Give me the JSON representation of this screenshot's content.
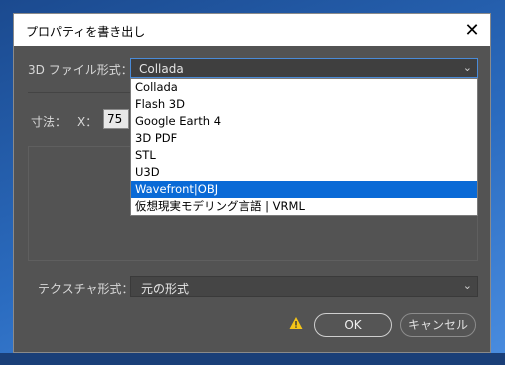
{
  "window": {
    "title": "プロパティを書き出し"
  },
  "format_row": {
    "label": "3D ファイル形式：",
    "selected": "Collada",
    "options": [
      "Collada",
      "Flash 3D",
      "Google Earth 4",
      "3D PDF",
      "STL",
      "U3D",
      "Wavefront|OBJ",
      "仮想現実モデリング言語 | VRML"
    ],
    "highlighted": "Wavefront|OBJ"
  },
  "size_row": {
    "label": "寸法：",
    "x_label": "X：",
    "x_value": "75"
  },
  "texture_row": {
    "label": "テクスチャ形式：",
    "selected": "元の形式"
  },
  "buttons": {
    "ok": "OK",
    "cancel": "キャンセル"
  },
  "colors": {
    "highlight": "#0a6ad6",
    "warning": "#f5c518",
    "dialog_bg": "#535353"
  }
}
